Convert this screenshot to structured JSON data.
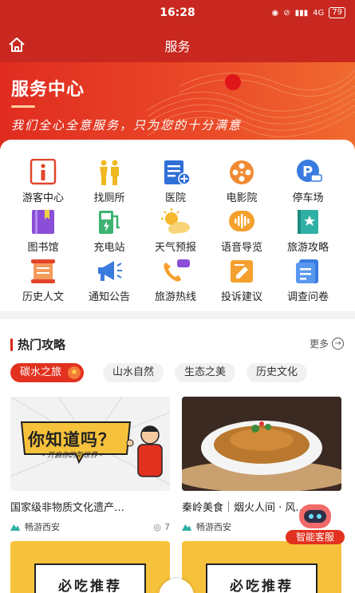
{
  "status_bar": {
    "time": "16:28",
    "network": "4G",
    "battery": "79"
  },
  "nav": {
    "title": "服务"
  },
  "hero": {
    "title": "服务中心",
    "slogan": "我们全心全意服务，只为您的十分满意"
  },
  "services": [
    {
      "label": "游客中心",
      "icon": "info-icon"
    },
    {
      "label": "找厕所",
      "icon": "toilet-icon"
    },
    {
      "label": "医院",
      "icon": "hospital-icon"
    },
    {
      "label": "电影院",
      "icon": "film-reel-icon"
    },
    {
      "label": "停车场",
      "icon": "parking-icon"
    },
    {
      "label": "图书馆",
      "icon": "book-icon"
    },
    {
      "label": "充电站",
      "icon": "charging-station-icon"
    },
    {
      "label": "天气预报",
      "icon": "weather-icon"
    },
    {
      "label": "语音导览",
      "icon": "voice-guide-icon"
    },
    {
      "label": "旅游攻略",
      "icon": "guide-book-icon"
    },
    {
      "label": "历史人文",
      "icon": "scroll-icon"
    },
    {
      "label": "通知公告",
      "icon": "megaphone-icon"
    },
    {
      "label": "旅游热线",
      "icon": "hotline-icon"
    },
    {
      "label": "投诉建议",
      "icon": "complaint-icon"
    },
    {
      "label": "调查问卷",
      "icon": "survey-icon"
    }
  ],
  "hot": {
    "title": "热门攻略",
    "more": "更多",
    "tags": [
      "碳水之旅",
      "山水自然",
      "生态之美",
      "历史文化"
    ],
    "articles": [
      {
        "title": "国家级非物质文化遗产…",
        "author": "畅游西安",
        "views": "7",
        "banner": "你知道吗？",
        "banner_sub": "- 开启你的新世界 -"
      },
      {
        "title": "秦岭美食｜烟火人间 · 风…",
        "author": "畅游西安",
        "views": ""
      }
    ],
    "bottom_cards": [
      "必吃推荐",
      "必吃推荐"
    ]
  },
  "smart_service": {
    "label": "智能客服"
  },
  "colors": {
    "primary": "#c8281f",
    "accent": "#e2321f"
  }
}
